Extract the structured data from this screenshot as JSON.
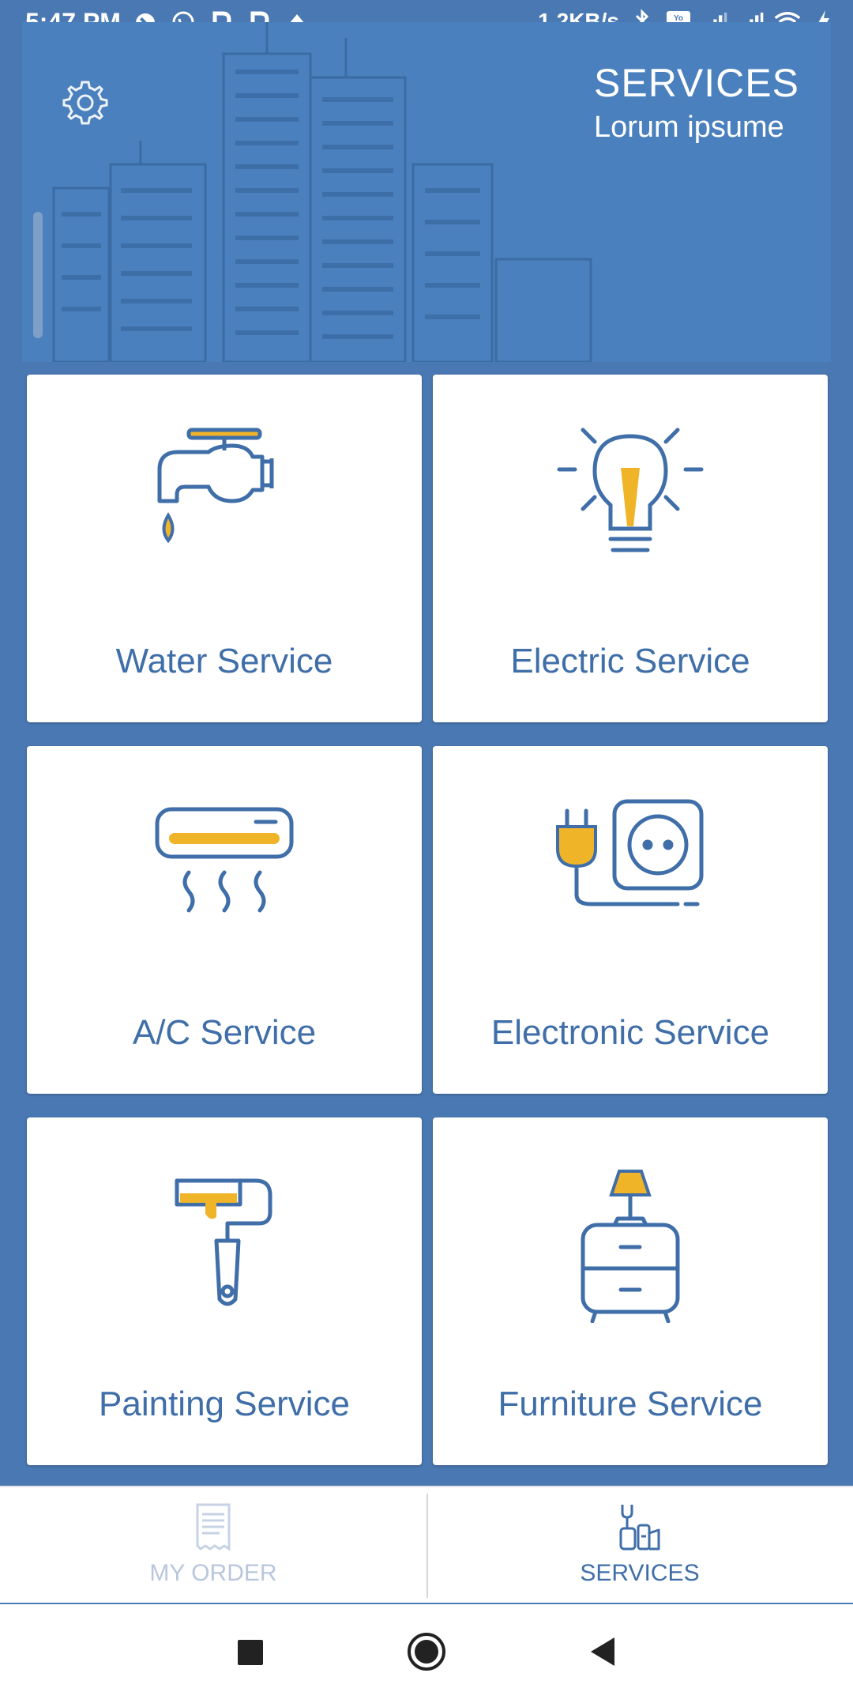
{
  "status": {
    "time": "5:47 PM",
    "speed": "1.2KB/s"
  },
  "header": {
    "title": "SERVICES",
    "subtitle": "Lorum ipsume"
  },
  "services": [
    {
      "label": "Water Service",
      "icon": "water-tap-icon"
    },
    {
      "label": "Electric Service",
      "icon": "light-bulb-icon"
    },
    {
      "label": "A/C Service",
      "icon": "air-conditioner-icon"
    },
    {
      "label": "Electronic Service",
      "icon": "plug-socket-icon"
    },
    {
      "label": "Painting Service",
      "icon": "paint-roller-icon"
    },
    {
      "label": "Furniture Service",
      "icon": "furniture-lamp-icon"
    }
  ],
  "bottom_nav": {
    "my_order": "MY ORDER",
    "services": "SERVICES"
  },
  "colors": {
    "primary": "#4a78b2",
    "accent": "#f0b429",
    "text": "#3f6ea8"
  }
}
